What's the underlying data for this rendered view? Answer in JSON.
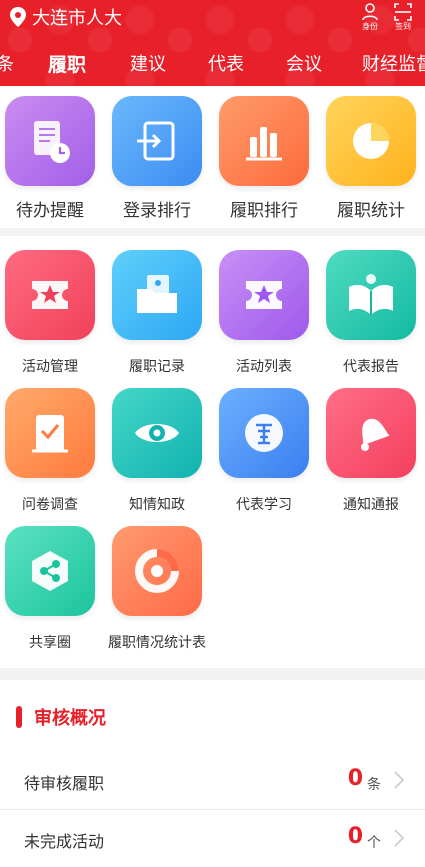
{
  "header": {
    "city": "大连市人大",
    "identity_label": "身份",
    "scan_label": "签到"
  },
  "tabs": [
    {
      "label": "条"
    },
    {
      "label": "履职"
    },
    {
      "label": "建议"
    },
    {
      "label": "代表"
    },
    {
      "label": "会议"
    },
    {
      "label": "财经监督"
    }
  ],
  "top_grid": [
    {
      "label": "待办提醒",
      "icon": "document-clock-icon"
    },
    {
      "label": "登录排行",
      "icon": "login-icon"
    },
    {
      "label": "履职排行",
      "icon": "bar-chart-icon"
    },
    {
      "label": "履职统计",
      "icon": "pie-chart-icon"
    }
  ],
  "main_grid": [
    {
      "label": "活动管理",
      "icon": "ticket-star-icon"
    },
    {
      "label": "履职记录",
      "icon": "folder-doc-icon"
    },
    {
      "label": "活动列表",
      "icon": "ticket-star-icon"
    },
    {
      "label": "代表报告",
      "icon": "open-book-icon"
    },
    {
      "label": "问卷调查",
      "icon": "scroll-check-icon"
    },
    {
      "label": "知情知政",
      "icon": "eye-icon"
    },
    {
      "label": "代表学习",
      "icon": "study-icon"
    },
    {
      "label": "通知通报",
      "icon": "bell-icon"
    },
    {
      "label": "共享圈",
      "icon": "share-icon"
    },
    {
      "label": "履职情况统计表",
      "icon": "donut-icon"
    }
  ],
  "review": {
    "title": "审核概况",
    "rows": [
      {
        "name": "待审核履职",
        "count": "0",
        "unit": "条"
      },
      {
        "name": "未完成活动",
        "count": "0",
        "unit": "个"
      }
    ]
  },
  "colors": {
    "brand": "#e8202a"
  }
}
